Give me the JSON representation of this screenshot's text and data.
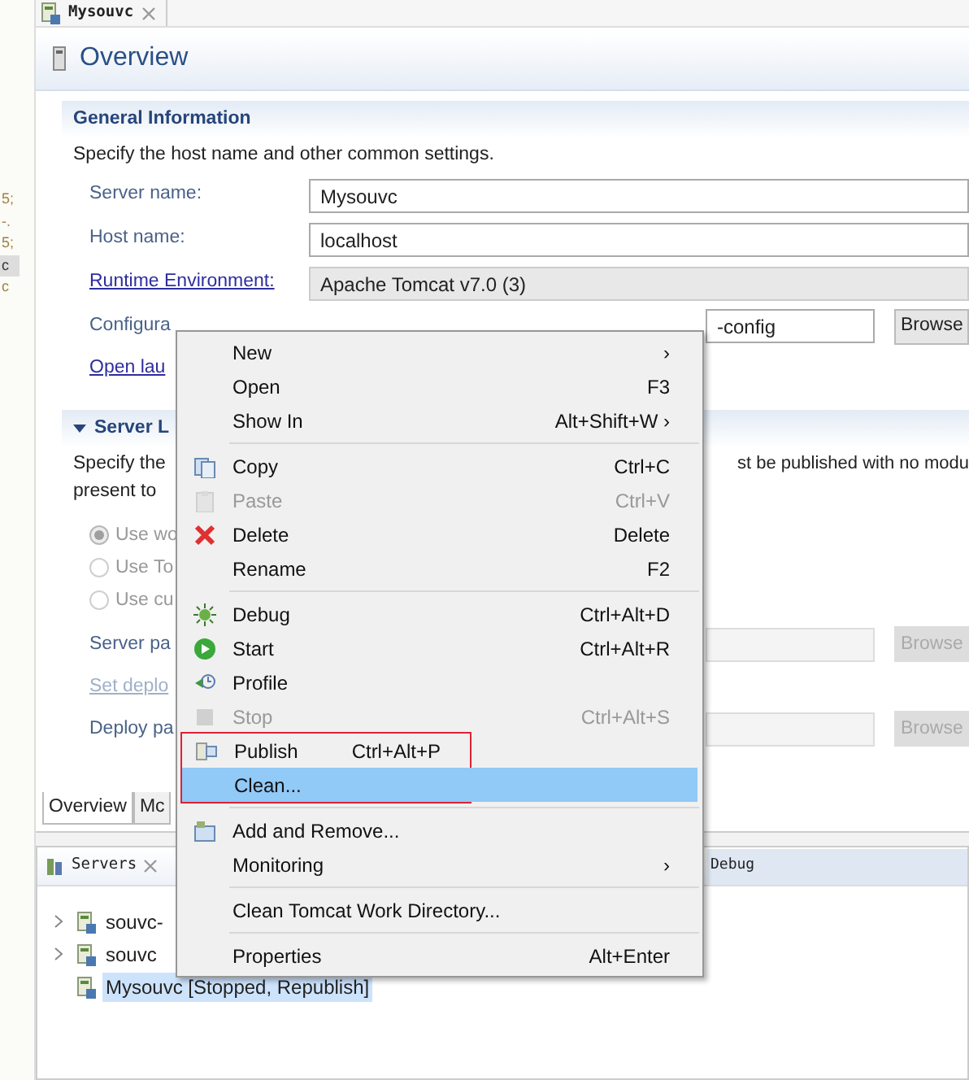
{
  "side_fragments": [
    {
      "text": "5;",
      "selected": false
    },
    {
      "text": "-.",
      "selected": false
    },
    {
      "text": "5;",
      "selected": false
    },
    {
      "text": "c",
      "selected": true
    },
    {
      "text": "c",
      "selected": false
    }
  ],
  "editor_tab": {
    "title": "Mysouvc"
  },
  "page_title": "Overview",
  "general": {
    "title": "General Information",
    "description": "Specify the host name and other common settings.",
    "rows": [
      {
        "label": "Server name:",
        "link": false,
        "readonly": false,
        "value": "Mysouvc"
      },
      {
        "label": "Host name:",
        "link": false,
        "readonly": false,
        "value": "localhost"
      },
      {
        "label": "Runtime Environment:",
        "link": true,
        "readonly": true,
        "value": "Apache Tomcat v7.0 (3)"
      }
    ],
    "rows_behind_menu": [
      {
        "label": "Configura",
        "link": false,
        "value": "-config",
        "button": "Browse"
      },
      {
        "label": "Open lau",
        "link": true
      }
    ]
  },
  "server_locations": {
    "title": "Server L",
    "expanded": true,
    "description_left": [
      "Specify the",
      "present to"
    ],
    "description_right": "st be published with no modu",
    "options": [
      {
        "label": "Use wo",
        "selected": true,
        "disabled": true
      },
      {
        "label": "Use To",
        "selected": false,
        "disabled": true
      },
      {
        "label": "Use cu",
        "selected": false,
        "disabled": true
      }
    ],
    "rows": [
      {
        "label": "Server pa",
        "link": false,
        "button": "Browse",
        "disabled": true
      },
      {
        "label": "Set deplo",
        "link": true,
        "disabled": true
      },
      {
        "label": "Deploy pa",
        "link": false,
        "button": "Browse",
        "disabled": true
      }
    ]
  },
  "editor_tabs": [
    {
      "label": "Overview",
      "selected": true
    },
    {
      "label": "Mc",
      "selected": false
    }
  ],
  "servers_view": {
    "title": "Servers",
    "side_tab": "Debug",
    "tree": [
      {
        "label": "souvc-",
        "expandable": true,
        "selected": false
      },
      {
        "label": "souvc",
        "expandable": true,
        "selected": false
      },
      {
        "label": "Mysouvc [Stopped, Republish]",
        "expandable": false,
        "selected": true
      }
    ]
  },
  "context_menu": {
    "groups": [
      [
        {
          "label": "New",
          "shortcut": "›",
          "kind": "plain",
          "disabled": false,
          "selected": false,
          "outlined": false
        },
        {
          "label": "Open",
          "shortcut": "F3",
          "kind": "plain",
          "disabled": false,
          "selected": false,
          "outlined": false
        },
        {
          "label": "Show In",
          "shortcut": "Alt+Shift+W ›",
          "kind": "plain",
          "disabled": false,
          "selected": false,
          "outlined": false
        }
      ],
      [
        {
          "label": "Copy",
          "shortcut": "Ctrl+C",
          "kind": "copy",
          "disabled": false,
          "selected": false,
          "outlined": false
        },
        {
          "label": "Paste",
          "shortcut": "Ctrl+V",
          "kind": "paste",
          "disabled": true,
          "selected": false,
          "outlined": false
        },
        {
          "label": "Delete",
          "shortcut": "Delete",
          "kind": "delete",
          "disabled": false,
          "selected": false,
          "outlined": false
        },
        {
          "label": "Rename",
          "shortcut": "F2",
          "kind": "plain",
          "disabled": false,
          "selected": false,
          "outlined": false
        }
      ],
      [
        {
          "label": "Debug",
          "shortcut": "Ctrl+Alt+D",
          "kind": "debug",
          "disabled": false,
          "selected": false,
          "outlined": false
        },
        {
          "label": "Start",
          "shortcut": "Ctrl+Alt+R",
          "kind": "start",
          "disabled": false,
          "selected": false,
          "outlined": false
        },
        {
          "label": "Profile",
          "kind": "profile",
          "disabled": false,
          "selected": false,
          "outlined": false
        },
        {
          "label": "Stop",
          "shortcut": "Ctrl+Alt+S",
          "kind": "stop",
          "disabled": true,
          "selected": false,
          "outlined": false
        },
        {
          "label": "Publish",
          "shortcut": "Ctrl+Alt+P",
          "kind": "publish",
          "disabled": false,
          "selected": false,
          "outlined": true
        },
        {
          "label": "Clean...",
          "kind": "plain",
          "disabled": false,
          "selected": true,
          "outlined": true
        }
      ],
      [
        {
          "label": "Add and Remove...",
          "kind": "add",
          "disabled": false,
          "selected": false,
          "outlined": false
        },
        {
          "label": "Monitoring",
          "shortcut": "›",
          "kind": "plain",
          "disabled": false,
          "selected": false,
          "outlined": false
        }
      ],
      [
        {
          "label": "Clean Tomcat Work Directory...",
          "kind": "plain",
          "disabled": false,
          "selected": false,
          "outlined": false
        }
      ],
      [
        {
          "label": "Properties",
          "shortcut": "Alt+Enter",
          "kind": "plain",
          "disabled": false,
          "selected": false,
          "outlined": false
        }
      ]
    ]
  }
}
